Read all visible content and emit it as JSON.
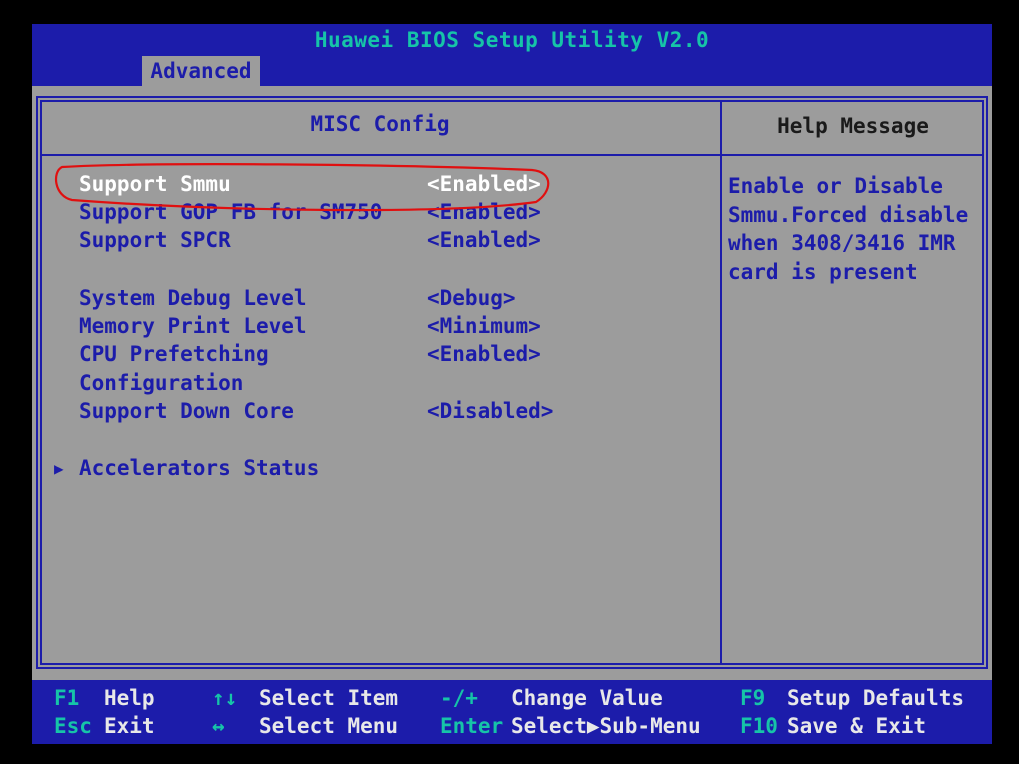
{
  "title": "Huawei BIOS Setup Utility V2.0",
  "tab": "Advanced",
  "panel_title": "MISC Config",
  "help": {
    "title": "Help Message",
    "lines": [
      "Enable or Disable",
      "Smmu.Forced disable",
      "when 3408/3416 IMR",
      "card is present"
    ]
  },
  "items": [
    {
      "label": "Support Smmu",
      "value": "<Enabled>"
    },
    {
      "label": "Support GOP FB for SM750",
      "value": "<Enabled>"
    },
    {
      "label": "Support SPCR",
      "value": "<Enabled>"
    },
    {
      "label": "System Debug Level",
      "value": "<Debug>"
    },
    {
      "label": "Memory Print Level",
      "value": "<Minimum>"
    },
    {
      "label": "CPU Prefetching",
      "value": "<Enabled>"
    },
    {
      "label": "Configuration",
      "value": ""
    },
    {
      "label": "Support Down Core",
      "value": "<Disabled>"
    }
  ],
  "submenu": {
    "arrow": "▶",
    "label": "Accelerators Status"
  },
  "footer": {
    "f1_key": "F1",
    "f1_label": "Help",
    "esc_key": "Esc",
    "esc_label": "Exit",
    "updown_key": "↑↓",
    "updown_label": "Select Item",
    "leftright_key": "↔",
    "leftright_label": "Select Menu",
    "plusminus_key": "-/+",
    "plusminus_label": "Change Value",
    "enter_key": "Enter",
    "enter_label": "Select▶Sub-Menu",
    "f9_key": "F9",
    "f9_label": "Setup Defaults",
    "f10_key": "F10",
    "f10_label": "Save & Exit"
  },
  "colors": {
    "blue": "#1c1caa",
    "gray": "#9c9c9c",
    "cyan": "#16c4a8",
    "annotation": "#e01010"
  }
}
